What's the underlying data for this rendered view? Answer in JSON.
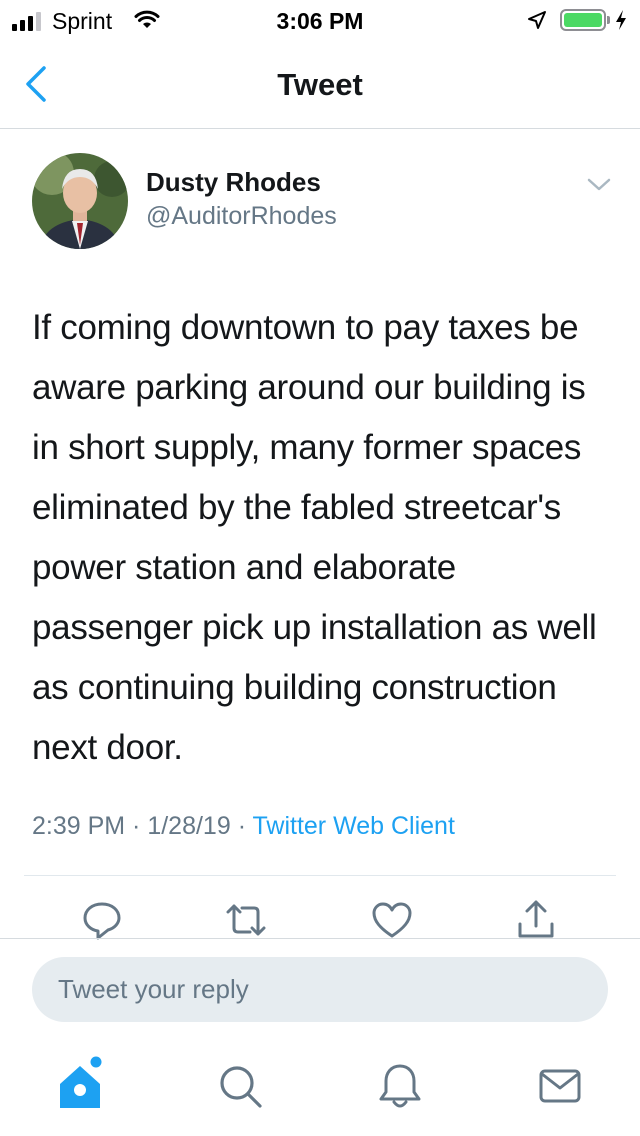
{
  "status_bar": {
    "carrier": "Sprint",
    "time": "3:06 PM",
    "signal_bars": 3,
    "battery_level": 1.0,
    "icons": [
      "signal-icon",
      "wifi-icon",
      "location-icon",
      "battery-icon",
      "charging-icon"
    ]
  },
  "nav": {
    "title": "Tweet",
    "back_icon": "back-chevron-icon"
  },
  "tweet": {
    "author_name": "Dusty Rhodes",
    "author_handle": "@AuditorRhodes",
    "text": "If coming downtown to pay taxes be aware parking around our building is in short supply, many former spaces eliminated by the fabled streetcar's power station and elaborate passenger pick up installation as well as continuing building construction next door.",
    "time": "2:39 PM",
    "sep1": " · ",
    "date": "1/28/19",
    "sep2": " · ",
    "source": "Twitter Web Client",
    "actions": [
      "reply-icon",
      "retweet-icon",
      "like-icon",
      "share-icon"
    ]
  },
  "reply": {
    "placeholder": "Tweet your reply"
  },
  "tabs": [
    "home-icon",
    "search-icon",
    "notifications-icon",
    "messages-icon"
  ],
  "colors": {
    "accent": "#1da1f2",
    "secondary_text": "#657786",
    "icon_gray": "#657786",
    "battery": "#4cd964"
  }
}
